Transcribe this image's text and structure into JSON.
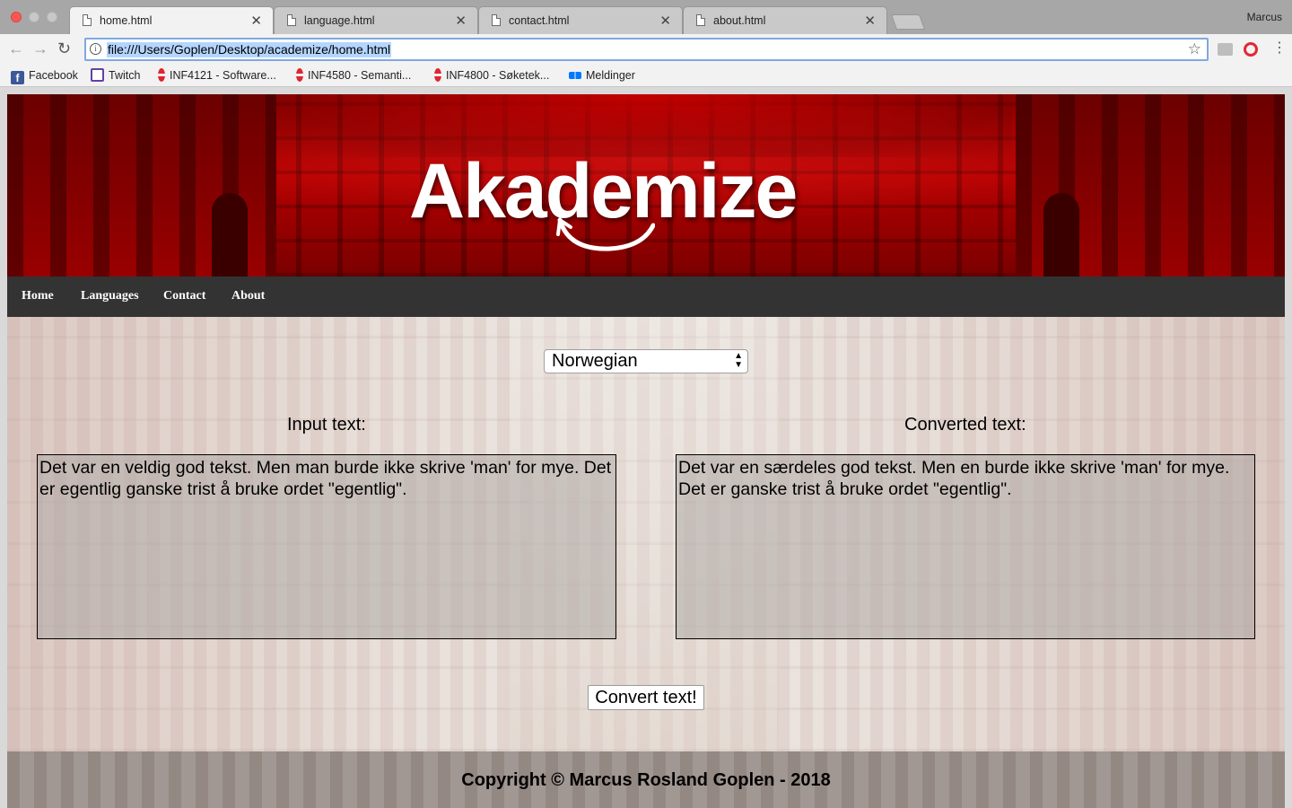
{
  "browser": {
    "tabs": [
      {
        "title": "home.html",
        "active": true
      },
      {
        "title": "language.html",
        "active": false
      },
      {
        "title": "contact.html",
        "active": false
      },
      {
        "title": "about.html",
        "active": false
      }
    ],
    "tab_close_glyph": "✕",
    "profile_name": "Marcus",
    "url": "file:///Users/Goplen/Desktop/academize/home.html",
    "bookmarks": [
      {
        "label": "Facebook",
        "icon": "facebook-icon"
      },
      {
        "label": "Twitch",
        "icon": "twitch-icon"
      },
      {
        "label": "INF4121 - Software...",
        "icon": "uio-icon"
      },
      {
        "label": "INF4580 - Semanti...",
        "icon": "uio-icon"
      },
      {
        "label": "INF4800 - Søketek...",
        "icon": "uio-icon"
      },
      {
        "label": "Meldinger",
        "icon": "messenger-icon"
      }
    ]
  },
  "site": {
    "logo": "Akademize",
    "nav": [
      "Home",
      "Languages",
      "Contact",
      "About"
    ],
    "language_select": {
      "selected": "Norwegian"
    },
    "input_label": "Input text:",
    "output_label": "Converted text:",
    "input_text": "Det var en veldig god tekst. Men man burde ikke skrive 'man' for mye. Det er egentlig ganske trist å bruke ordet \"egentlig\".",
    "output_text": "Det var en særdeles god tekst. Men en burde ikke skrive 'man' for mye. Det er ganske trist å bruke ordet \"egentlig\".",
    "convert_button": "Convert text!",
    "footer": "Copyright © Marcus Rosland Goplen - 2018"
  },
  "colors": {
    "header_red": "#b40000",
    "navbar": "#333333",
    "close_button": "#fc5753",
    "omnibox_focus": "#7fa9e1"
  }
}
